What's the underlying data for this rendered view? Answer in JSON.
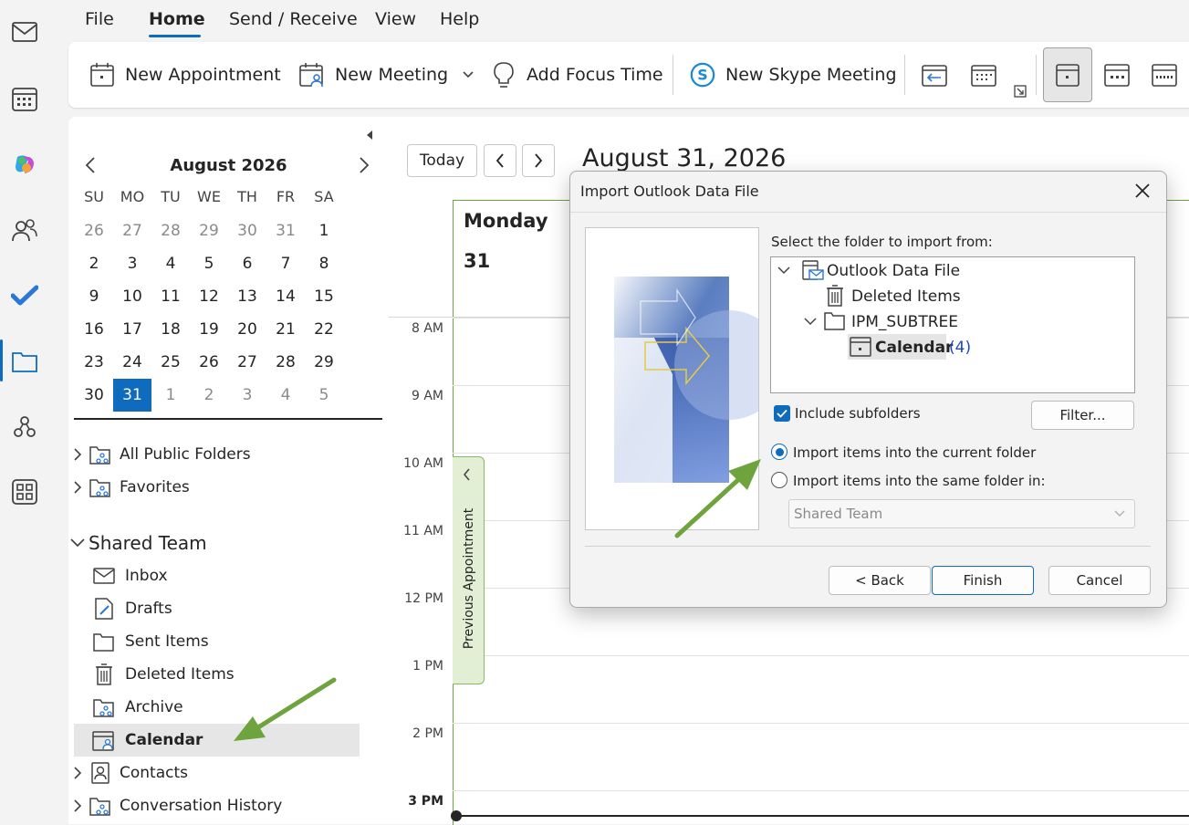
{
  "menu": {
    "file": "File",
    "home": "Home",
    "send_receive": "Send / Receive",
    "view": "View",
    "help": "Help"
  },
  "ribbon": {
    "new_appointment": "New Appointment",
    "new_meeting": "New Meeting",
    "add_focus_time": "Add Focus Time",
    "new_skype_meeting": "New Skype Meeting"
  },
  "mini_calendar": {
    "month": "August 2026",
    "dow": [
      "SU",
      "MO",
      "TU",
      "WE",
      "TH",
      "FR",
      "SA"
    ],
    "weeks": [
      [
        "26",
        "27",
        "28",
        "29",
        "30",
        "31",
        "1"
      ],
      [
        "2",
        "3",
        "4",
        "5",
        "6",
        "7",
        "8"
      ],
      [
        "9",
        "10",
        "11",
        "12",
        "13",
        "14",
        "15"
      ],
      [
        "16",
        "17",
        "18",
        "19",
        "20",
        "21",
        "22"
      ],
      [
        "23",
        "24",
        "25",
        "26",
        "27",
        "28",
        "29"
      ],
      [
        "30",
        "31",
        "1",
        "2",
        "3",
        "4",
        "5"
      ]
    ]
  },
  "folders": {
    "all_public": "All Public Folders",
    "favorites": "Favorites",
    "shared_team": "Shared Team",
    "inbox": "Inbox",
    "drafts": "Drafts",
    "sent": "Sent Items",
    "deleted": "Deleted Items",
    "archive": "Archive",
    "calendar": "Calendar",
    "contacts": "Contacts",
    "conversation_history": "Conversation History"
  },
  "calendar_view": {
    "today": "Today",
    "date_title": "August 31, 2026",
    "day_name": "Monday",
    "day_num": "31",
    "times": [
      "8 AM",
      "9 AM",
      "10 AM",
      "11 AM",
      "12 PM",
      "1 PM",
      "2 PM",
      "3 PM"
    ],
    "prev_appt": "Previous Appointment"
  },
  "dialog": {
    "title": "Import Outlook Data File",
    "select_label": "Select the folder to import from:",
    "tree": {
      "root": "Outlook Data File",
      "deleted": "Deleted Items",
      "ipm": "IPM_SUBTREE",
      "calendar": "Calendar",
      "calendar_count": "(4)"
    },
    "include_subfolders": "Include subfolders",
    "filter": "Filter...",
    "radio_current": "Import items into the current folder",
    "radio_same": "Import items into the same folder in:",
    "same_folder_value": "Shared Team",
    "back": "< Back",
    "finish": "Finish",
    "cancel": "Cancel"
  },
  "colors": {
    "accent": "#0f6cbd",
    "arrow": "#6ea33d"
  }
}
